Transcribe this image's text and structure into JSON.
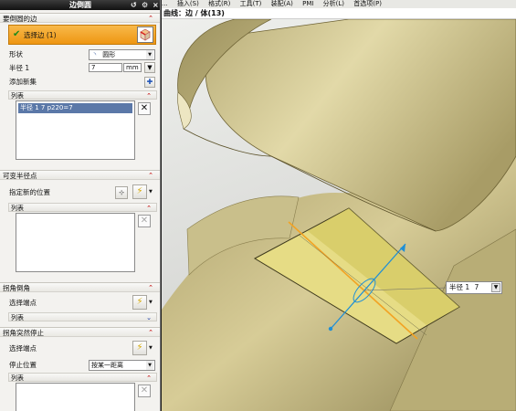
{
  "panel": {
    "title": "边倒圆",
    "title_icons": [
      "undo-icon",
      "gear-icon",
      "close-icon"
    ],
    "edges_section": "要倒圆的边",
    "select_edge_label": "选择边 (1)",
    "shape_label": "形状",
    "shape_value": "圆形",
    "radius_label": "半径 1",
    "radius_value": "7",
    "radius_unit": "mm",
    "add_new_set_label": "添加新集",
    "list_label": "列表",
    "list_items": [
      "半径 1  7  p220=7"
    ],
    "variable_radius_section": "可变半径点",
    "specify_location_label": "指定新的位置",
    "list2_label": "列表",
    "corner_setback_section": "拐角倒角",
    "select_endpoint_label": "选择端点",
    "list3_label": "列表",
    "corner_stop_section": "拐角突然停止",
    "select_endpoint2_label": "选择端点",
    "stop_location_label": "停止位置",
    "stop_location_value": "按某一距离",
    "list4_label": "列表"
  },
  "menubar": {
    "items": [
      "...",
      "插入(S)",
      "格式(R)",
      "工具(T)",
      "装配(A)",
      "PMI",
      "分析(L)",
      "首选项(P)"
    ]
  },
  "status": {
    "text": "曲线：边 / 体(13)"
  },
  "radius_tag": {
    "label": "半径 1",
    "value": "7"
  },
  "colors": {
    "accent_orange": "#f2a324",
    "selection_blue": "#5b78a8",
    "model_tan": "#d6cc98"
  }
}
